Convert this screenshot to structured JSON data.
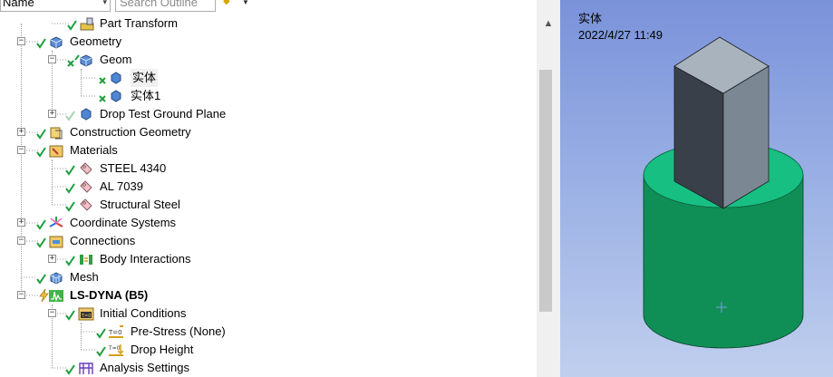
{
  "toolbar": {
    "filter_value": "Name",
    "search_placeholder": "Search Outline"
  },
  "tree": [
    {
      "label": "Part Transform",
      "icon": "part-transform-icon"
    },
    {
      "label": "Geometry",
      "icon": "geometry-icon"
    },
    {
      "label": "Geom",
      "icon": "geometry-part-icon"
    },
    {
      "label": "实体",
      "icon": "body-icon"
    },
    {
      "label": "实体1",
      "icon": "body-icon"
    },
    {
      "label": "Drop Test Ground Plane",
      "icon": "body-icon"
    },
    {
      "label": "Construction Geometry",
      "icon": "construction-geometry-icon"
    },
    {
      "label": "Materials",
      "icon": "materials-icon"
    },
    {
      "label": "STEEL 4340",
      "icon": "material-icon"
    },
    {
      "label": "AL 7039",
      "icon": "material-icon"
    },
    {
      "label": "Structural Steel",
      "icon": "material-icon"
    },
    {
      "label": "Coordinate Systems",
      "icon": "coordinate-systems-icon"
    },
    {
      "label": "Connections",
      "icon": "connections-icon"
    },
    {
      "label": "Body Interactions",
      "icon": "body-interactions-icon"
    },
    {
      "label": "Mesh",
      "icon": "mesh-icon"
    },
    {
      "label": "LS-DYNA (B5)",
      "icon": "ls-dyna-icon"
    },
    {
      "label": "Initial Conditions",
      "icon": "initial-conditions-icon"
    },
    {
      "label": "Pre-Stress (None)",
      "icon": "pre-stress-icon"
    },
    {
      "label": "Drop Height",
      "icon": "drop-height-icon"
    },
    {
      "label": "Analysis Settings",
      "icon": "analysis-settings-icon"
    }
  ],
  "viewport": {
    "title": "实体",
    "timestamp": "2022/4/27 11:49"
  },
  "colors": {
    "check_green": "#1e9e3c",
    "box_front": "#3a4049",
    "box_side": "#7b8893",
    "box_top": "#a9b3bd",
    "cylinder_side": "#0f8f56",
    "cylinder_top": "#17c082"
  }
}
